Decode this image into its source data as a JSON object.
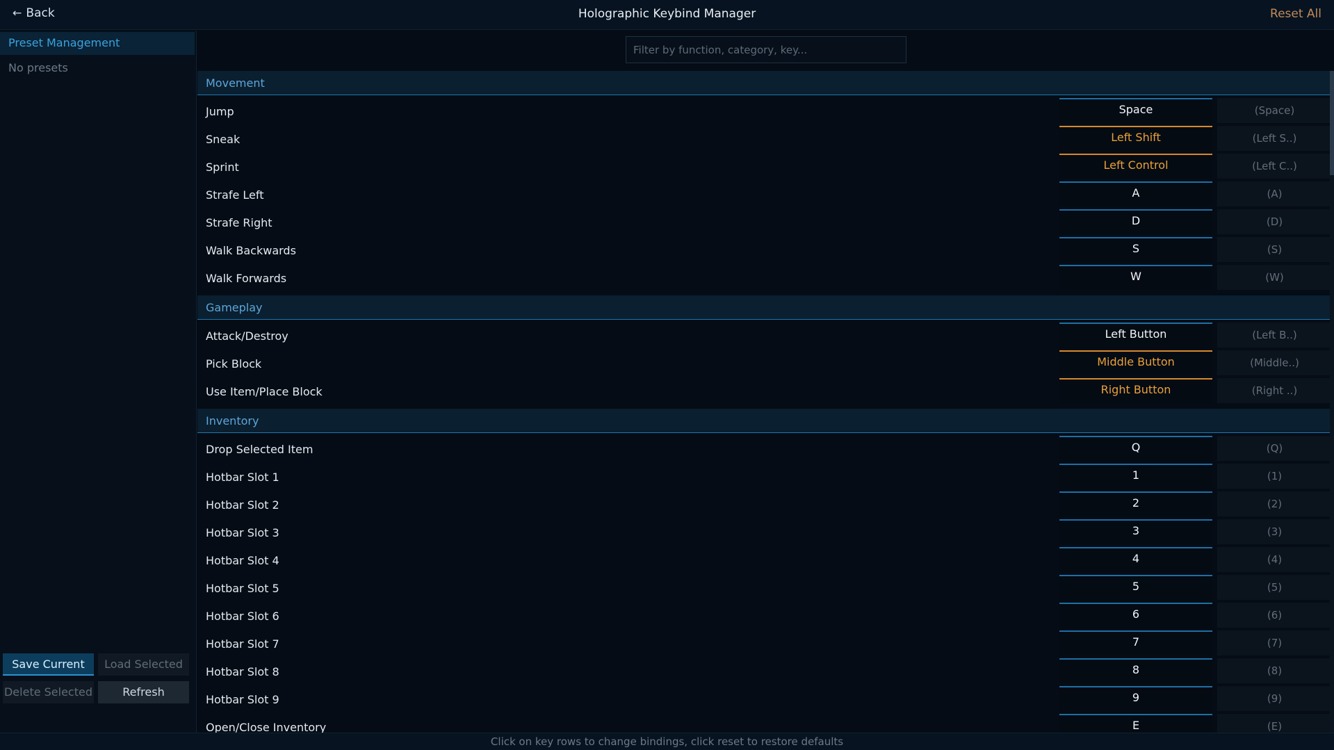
{
  "header": {
    "back_label": "Back",
    "title": "Holographic Keybind Manager",
    "reset_all_label": "Reset All"
  },
  "sidebar": {
    "title": "Preset Management",
    "empty_text": "No presets",
    "buttons": {
      "save": "Save Current",
      "load": "Load Selected",
      "delete": "Delete Selected",
      "refresh": "Refresh"
    }
  },
  "filter": {
    "placeholder": "Filter by function, category, key..."
  },
  "categories": [
    {
      "name": "Movement",
      "rows": [
        {
          "label": "Jump",
          "key": "Space",
          "default": "(Space)",
          "modified": false
        },
        {
          "label": "Sneak",
          "key": "Left Shift",
          "default": "(Left S..)",
          "modified": true
        },
        {
          "label": "Sprint",
          "key": "Left Control",
          "default": "(Left C..)",
          "modified": true
        },
        {
          "label": "Strafe Left",
          "key": "A",
          "default": "(A)",
          "modified": false
        },
        {
          "label": "Strafe Right",
          "key": "D",
          "default": "(D)",
          "modified": false
        },
        {
          "label": "Walk Backwards",
          "key": "S",
          "default": "(S)",
          "modified": false
        },
        {
          "label": "Walk Forwards",
          "key": "W",
          "default": "(W)",
          "modified": false
        }
      ]
    },
    {
      "name": "Gameplay",
      "rows": [
        {
          "label": "Attack/Destroy",
          "key": "Left Button",
          "default": "(Left B..)",
          "modified": false
        },
        {
          "label": "Pick Block",
          "key": "Middle Button",
          "default": "(Middle..)",
          "modified": true
        },
        {
          "label": "Use Item/Place Block",
          "key": "Right Button",
          "default": "(Right ..)",
          "modified": true
        }
      ]
    },
    {
      "name": "Inventory",
      "rows": [
        {
          "label": "Drop Selected Item",
          "key": "Q",
          "default": "(Q)",
          "modified": false
        },
        {
          "label": "Hotbar Slot 1",
          "key": "1",
          "default": "(1)",
          "modified": false
        },
        {
          "label": "Hotbar Slot 2",
          "key": "2",
          "default": "(2)",
          "modified": false
        },
        {
          "label": "Hotbar Slot 3",
          "key": "3",
          "default": "(3)",
          "modified": false
        },
        {
          "label": "Hotbar Slot 4",
          "key": "4",
          "default": "(4)",
          "modified": false
        },
        {
          "label": "Hotbar Slot 5",
          "key": "5",
          "default": "(5)",
          "modified": false
        },
        {
          "label": "Hotbar Slot 6",
          "key": "6",
          "default": "(6)",
          "modified": false
        },
        {
          "label": "Hotbar Slot 7",
          "key": "7",
          "default": "(7)",
          "modified": false
        },
        {
          "label": "Hotbar Slot 8",
          "key": "8",
          "default": "(8)",
          "modified": false
        },
        {
          "label": "Hotbar Slot 9",
          "key": "9",
          "default": "(9)",
          "modified": false
        },
        {
          "label": "Open/Close Inventory",
          "key": "E",
          "default": "(E)",
          "modified": false
        }
      ]
    }
  ],
  "footer": {
    "hint": "Click on key rows to change bindings, click reset to restore defaults"
  },
  "colors": {
    "accent": "#3aa3df",
    "modified": "#e9a13a",
    "background": "#050c15"
  }
}
